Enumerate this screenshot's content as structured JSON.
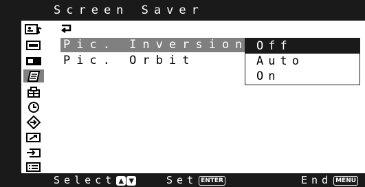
{
  "menu": {
    "title": "Screen Saver",
    "items": [
      {
        "label": "Pic. Inversion:",
        "selected": true
      },
      {
        "label": "Pic. Orbit",
        "selected": false
      }
    ],
    "options": [
      "Off",
      "Auto",
      "On"
    ],
    "selected_option": "Off"
  },
  "icons": [
    "picture-sound-icon",
    "input-icon",
    "pip-icon",
    "screen-saver-icon",
    "setup-icon",
    "timer-icon",
    "position-icon",
    "resize-icon",
    "signal-input-icon",
    "info-icon"
  ],
  "footer": {
    "select_label": "Select",
    "set_label": "Set",
    "set_key": "ENTER",
    "end_label": "End",
    "end_key": "MENU"
  }
}
